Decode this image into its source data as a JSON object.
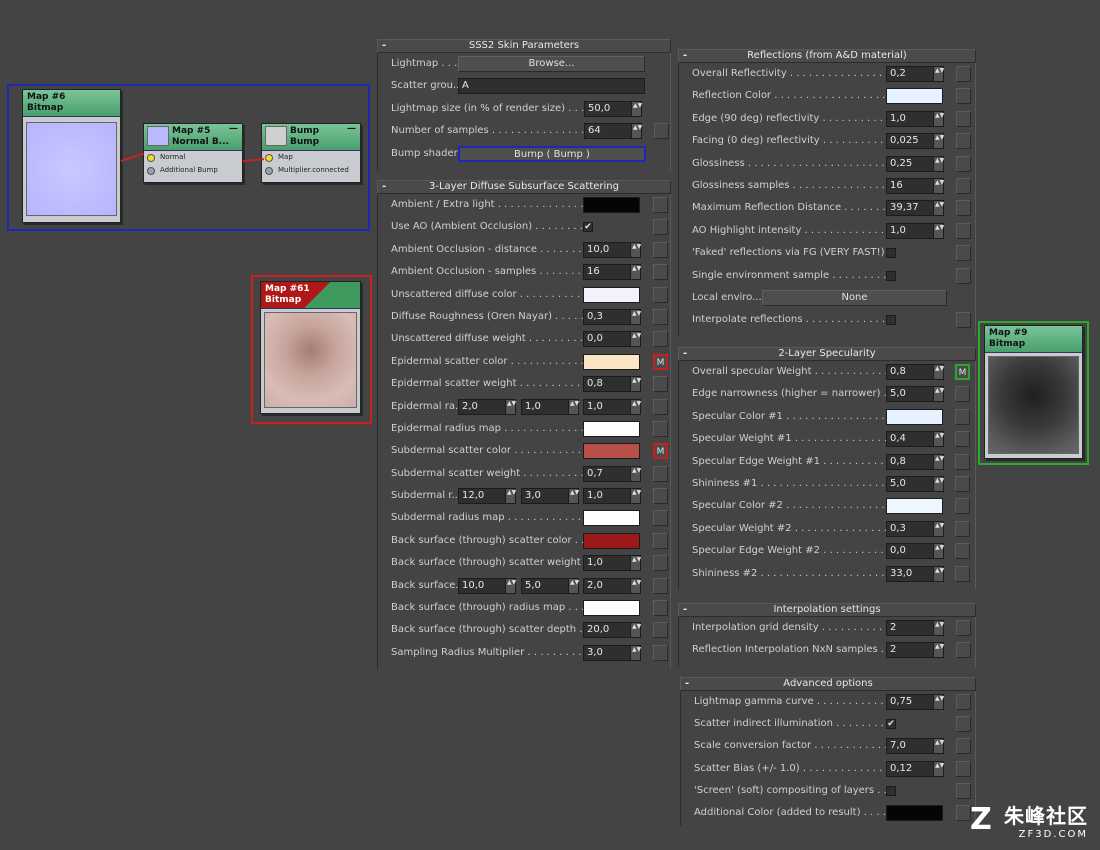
{
  "nodes": {
    "map6": {
      "title": "Map #6",
      "subtitle": "Bitmap"
    },
    "map5": {
      "title": "Map #5",
      "subtitle": "Normal  B...",
      "sockets": [
        "Normal",
        "Additional Bump"
      ]
    },
    "bump": {
      "title": "Bump",
      "subtitle": "Bump",
      "sockets": [
        "Map",
        "Multiplier.connected"
      ]
    },
    "map61": {
      "title": "Map #61",
      "subtitle": "Bitmap"
    },
    "map9": {
      "title": "Map #9",
      "subtitle": "Bitmap"
    },
    "minimize_glyph": "—"
  },
  "sss2": {
    "title": "SSS2 Skin Parameters",
    "lightmap": {
      "label": "Lightmap . . . .",
      "button": "Browse..."
    },
    "scatter_group": {
      "label": "Scatter grou...",
      "value": "A"
    },
    "lightmap_size": {
      "label": "Lightmap size (in % of render size) . . . . . .",
      "value": "50,0"
    },
    "samples": {
      "label": "Number of samples . . . . . . . . . . . . . . .",
      "value": "64"
    },
    "bump_shader": {
      "label": "Bump shader .",
      "button": "Bump  ( Bump )"
    }
  },
  "diffuse": {
    "title": "3-Layer Diffuse Subsurface Scattering",
    "rows": [
      {
        "label": "Ambient / Extra light . . . . . . . . . . . . . . . .",
        "swatch": "#050505"
      },
      {
        "label": "Use AO (Ambient Occlusion) . . . . . . . . . .",
        "check": "✔"
      },
      {
        "label": "Ambient Occlusion - distance . . . . . . . . . .",
        "value": "10,0"
      },
      {
        "label": "Ambient Occlusion - samples . . . . . . . . . .",
        "value": "16"
      },
      {
        "label": "Unscattered diffuse color . . . . . . . . . . . .",
        "swatch": "#f2f2ff"
      },
      {
        "label": "Diffuse Roughness (Oren Nayar) . . . . . . . .",
        "value": "0,3"
      },
      {
        "label": "Unscattered diffuse weight . . . . . . . . . . . .",
        "value": "0,0"
      },
      {
        "label": "Epidermal scatter color . . . . . . . . . . . . . .",
        "swatch": "#fbe5c4",
        "map": "M"
      },
      {
        "label": "Epidermal scatter weight . . . . . . . . . . . . .",
        "value": "0,8"
      },
      {
        "label": "Epidermal ra...",
        "triple": [
          "2,0",
          "1,0",
          "1,0"
        ]
      },
      {
        "label": "Epidermal radius map . . . . . . . . . . . . . . .",
        "swatch": "#ffffff"
      },
      {
        "label": "Subdermal scatter color . . . . . . . . . . . . .",
        "swatch": "#b8504a",
        "map": "M"
      },
      {
        "label": "Subdermal scatter weight . . . . . . . . . . . .",
        "value": "0,7"
      },
      {
        "label": "Subdermal r...",
        "triple": [
          "12,0",
          "3,0",
          "1,0"
        ]
      },
      {
        "label": "Subdermal radius map . . . . . . . . . . . . . . .",
        "swatch": "#ffffff"
      },
      {
        "label": "Back surface (through) scatter color . . . . .",
        "swatch": "#9a1a1a"
      },
      {
        "label": "Back surface (through) scatter weight . . . .",
        "value": "1,0"
      },
      {
        "label": "Back surface...",
        "triple": [
          "10,0",
          "5,0",
          "2,0"
        ]
      },
      {
        "label": "Back surface (through) radius map . . . . . .",
        "swatch": "#ffffff"
      },
      {
        "label": "Back surface (through) scatter depth . . . .",
        "value": "20,0"
      },
      {
        "label": "Sampling Radius Multiplier . . . . . . . . . . .",
        "value": "3,0"
      }
    ]
  },
  "reflections": {
    "title": "Reflections (from A&D material)",
    "rows": [
      {
        "label": "Overall Reflectivity . . . . . . . . . . . . . . . . . .",
        "value": "0,2"
      },
      {
        "label": "Reflection Color . . . . . . . . . . . . . . . . . . . .",
        "swatch": "#e6f2ff"
      },
      {
        "label": "Edge (90 deg) reflectivity . . . . . . . . . . . . .",
        "value": "1,0"
      },
      {
        "label": "Facing (0 deg) reflectivity . . . . . . . . . . . .",
        "value": "0,025"
      },
      {
        "label": "Glossiness . . . . . . . . . . . . . . . . . . . . . . . .",
        "value": "0,25"
      },
      {
        "label": "Glossiness samples . . . . . . . . . . . . . . . . . .",
        "value": "16"
      },
      {
        "label": "Maximum Reflection Distance . . . . . . . . . .",
        "value": "39,37"
      },
      {
        "label": "AO Highlight intensity . . . . . . . . . . . . . . .",
        "value": "1,0"
      },
      {
        "label": "'Faked' reflections via FG (VERY FAST!) . . .",
        "check": ""
      },
      {
        "label": "Single environment sample . . . . . . . . . . .",
        "check": ""
      },
      {
        "label": "Local enviro...",
        "button": "None"
      },
      {
        "label": "Interpolate reflections . . . . . . . . . . . . . . .",
        "check": ""
      }
    ]
  },
  "specularity": {
    "title": "2-Layer Specularity",
    "rows": [
      {
        "label": "Overall specular Weight . . . . . . . . . . . . .",
        "value": "0,8",
        "map": "M"
      },
      {
        "label": "Edge narrowness (higher = narrower) . . . .",
        "value": "5,0"
      },
      {
        "label": "Specular Color #1 . . . . . . . . . . . . . . . . . .",
        "swatch": "#e6f2ff"
      },
      {
        "label": "Specular Weight #1 . . . . . . . . . . . . . . . . .",
        "value": "0,4"
      },
      {
        "label": "Specular Edge Weight #1 . . . . . . . . . . . . .",
        "value": "0,8"
      },
      {
        "label": "Shininess #1 . . . . . . . . . . . . . . . . . . . . . .",
        "value": "5,0"
      },
      {
        "label": "Specular Color #2 . . . . . . . . . . . . . . . . . .",
        "swatch": "#eef6ff"
      },
      {
        "label": "Specular Weight #2 . . . . . . . . . . . . . . . . .",
        "value": "0,3"
      },
      {
        "label": "Specular Edge Weight #2 . . . . . . . . . . . . .",
        "value": "0,0"
      },
      {
        "label": "Shininess #2 . . . . . . . . . . . . . . . . . . . . . .",
        "value": "33,0"
      }
    ]
  },
  "interpolation": {
    "title": "Interpolation settings",
    "rows": [
      {
        "label": "Interpolation grid density . . . . . . . . . . . .",
        "value": "2"
      },
      {
        "label": "Reflection Interpolation NxN samples . . . . .",
        "value": "2"
      }
    ]
  },
  "advanced": {
    "title": "Advanced options",
    "rows": [
      {
        "label": "Lightmap gamma curve . . . . . . . . . . . . . . .",
        "value": "0,75"
      },
      {
        "label": "Scatter indirect illumination . . . . . . . . . . .",
        "check": "✔"
      },
      {
        "label": "Scale conversion factor . . . . . . . . . . . . . .",
        "value": "7,0"
      },
      {
        "label": "Scatter Bias (+/- 1.0) . . . . . . . . . . . . . . .",
        "value": "0,12"
      },
      {
        "label": "'Screen' (soft) compositing of layers . . . . .",
        "check": ""
      },
      {
        "label": "Additional Color (added to result) . . . . . . .",
        "swatch": "#050505"
      }
    ]
  },
  "ui": {
    "minus": "-",
    "spin_arrows": "▲▼"
  },
  "watermark": {
    "main": "朱峰社区",
    "sub": "ZF3D.COM",
    "icon_glyph": "Z"
  },
  "colors": {
    "selection_blue": "#1a2bb0",
    "selection_red": "#c82020",
    "selection_green": "#2aaa2a"
  }
}
